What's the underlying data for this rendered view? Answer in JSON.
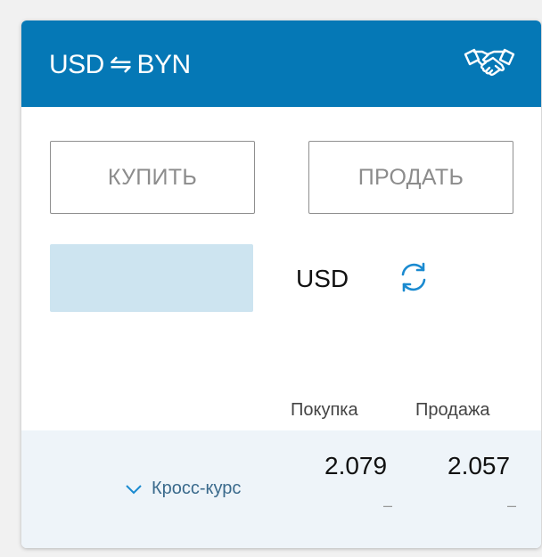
{
  "header": {
    "from_currency": "USD",
    "swap_symbol": "⇋",
    "to_currency": "BYN",
    "deal_icon": "handshake-icon"
  },
  "actions": {
    "buy_label": "КУПИТЬ",
    "sell_label": "ПРОДАТЬ"
  },
  "converter": {
    "amount_value": "",
    "currency": "USD",
    "refresh_icon": "refresh-icon"
  },
  "rates": {
    "buy_header": "Покупка",
    "sell_header": "Продажа",
    "cross_label": "Кросс-курс",
    "buy_value": "2.079",
    "sell_value": "2.057",
    "buy_sub": "–",
    "sell_sub": "–"
  },
  "colors": {
    "header_bg": "#0578b6",
    "input_bg": "#cde4f0",
    "rates_row_bg": "#eef4f9",
    "accent": "#1a8ad0"
  }
}
